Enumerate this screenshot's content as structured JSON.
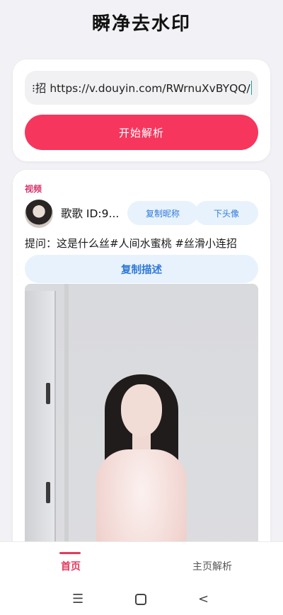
{
  "app": {
    "title": "瞬净去水印"
  },
  "input": {
    "value": "⁝招  https://v.douyin.com/RWrnuXvBYQQ/"
  },
  "actions": {
    "parse_label": "开始解析"
  },
  "result": {
    "section_tag": "视频",
    "author": "歌歌  ID:9...",
    "copy_nickname_label": "复制昵称",
    "download_avatar_label": "下头像",
    "description": "提问：这是什么丝#人间水蜜桃 #丝滑小连招",
    "copy_description_label": "复制描述"
  },
  "nav": {
    "home_label": "首页",
    "profile_parse_label": "主页解析"
  },
  "system": {
    "menu_glyph": "☰",
    "back_glyph": "<"
  },
  "colors": {
    "accent": "#f6365d",
    "pill_bg": "#e8f2fd",
    "pill_text": "#2f79d8",
    "tag": "#d6336c"
  }
}
